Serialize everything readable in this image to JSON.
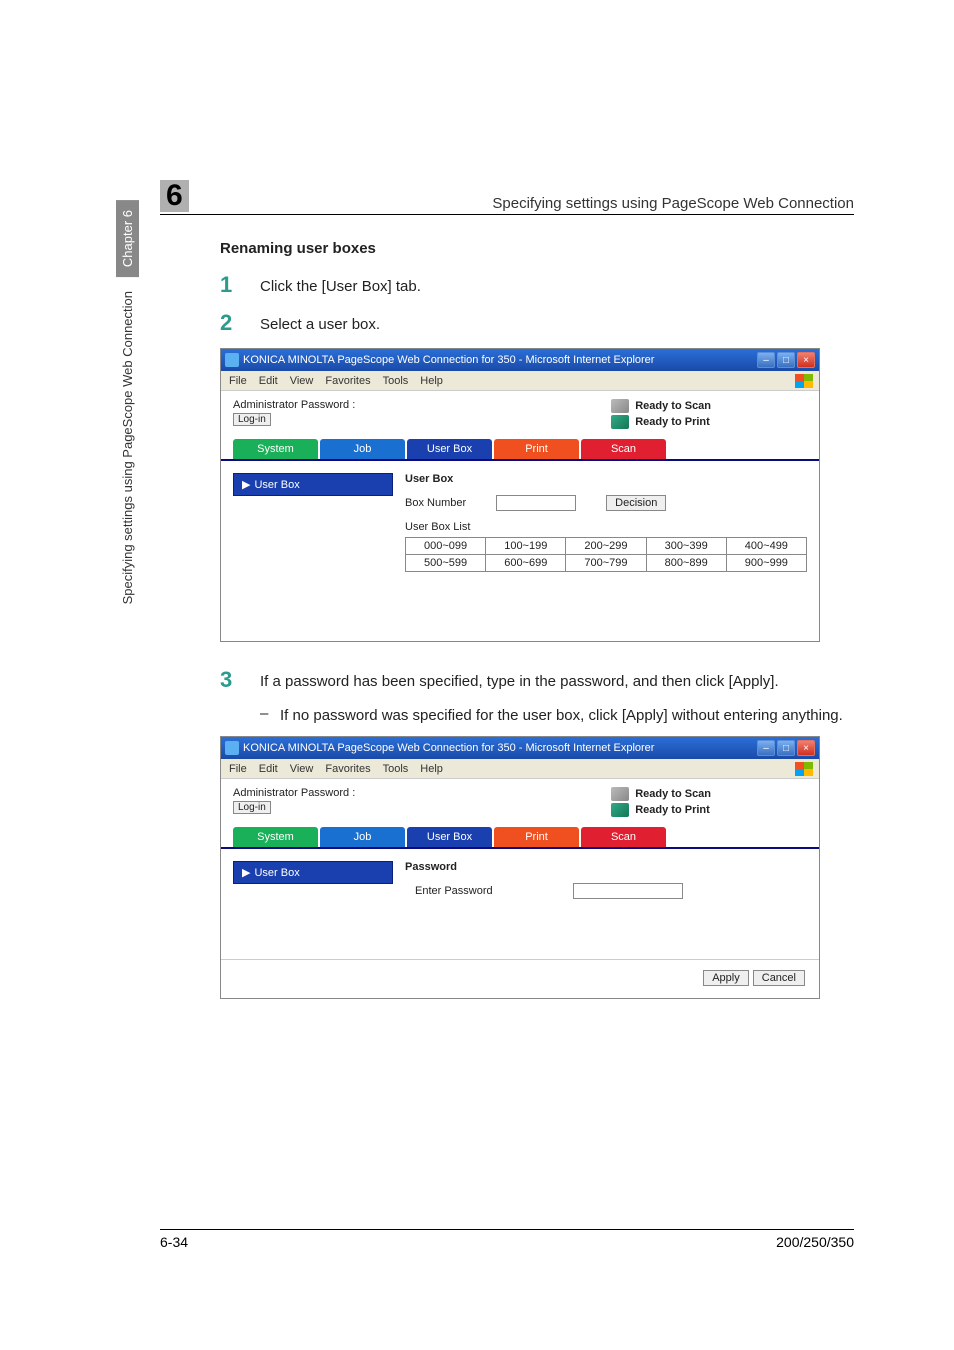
{
  "header": {
    "chapter_number": "6",
    "title": "Specifying settings using PageScope Web Connection"
  },
  "side": {
    "chapter_label": "Chapter 6",
    "spec_label": "Specifying settings using PageScope Web Connection"
  },
  "section": {
    "title": "Renaming user boxes"
  },
  "steps": {
    "s1": {
      "num": "1",
      "text": "Click the [User Box] tab."
    },
    "s2": {
      "num": "2",
      "text": "Select a user box."
    },
    "s3": {
      "num": "3",
      "text": "If a password has been specified, type in the password, and then click [Apply]."
    },
    "s3_sub": "If no password was specified for the user box, click [Apply] without entering anything."
  },
  "shot_common": {
    "window_title": "KONICA MINOLTA PageScope Web Connection for 350 - Microsoft Internet Explorer",
    "menus": {
      "file": "File",
      "edit": "Edit",
      "view": "View",
      "favorites": "Favorites",
      "tools": "Tools",
      "help": "Help"
    },
    "ready_scan": "Ready to Scan",
    "ready_print": "Ready to Print",
    "admin_label": "Administrator Password :",
    "login": "Log-in",
    "tabs": {
      "system": "System",
      "job": "Job",
      "userbox": "User Box",
      "print": "Print",
      "scan": "Scan"
    },
    "sidebar_userbox": "User Box"
  },
  "shot1": {
    "pane_title": "User Box",
    "box_number": "Box Number",
    "decision": "Decision",
    "list_title": "User Box List",
    "ranges": [
      [
        "000~099",
        "100~199",
        "200~299",
        "300~399",
        "400~499"
      ],
      [
        "500~599",
        "600~699",
        "700~799",
        "800~899",
        "900~999"
      ]
    ]
  },
  "shot2": {
    "pane_title": "Password",
    "enter_password": "Enter Password",
    "apply": "Apply",
    "cancel": "Cancel"
  },
  "footer": {
    "page": "6-34",
    "model": "200/250/350"
  }
}
